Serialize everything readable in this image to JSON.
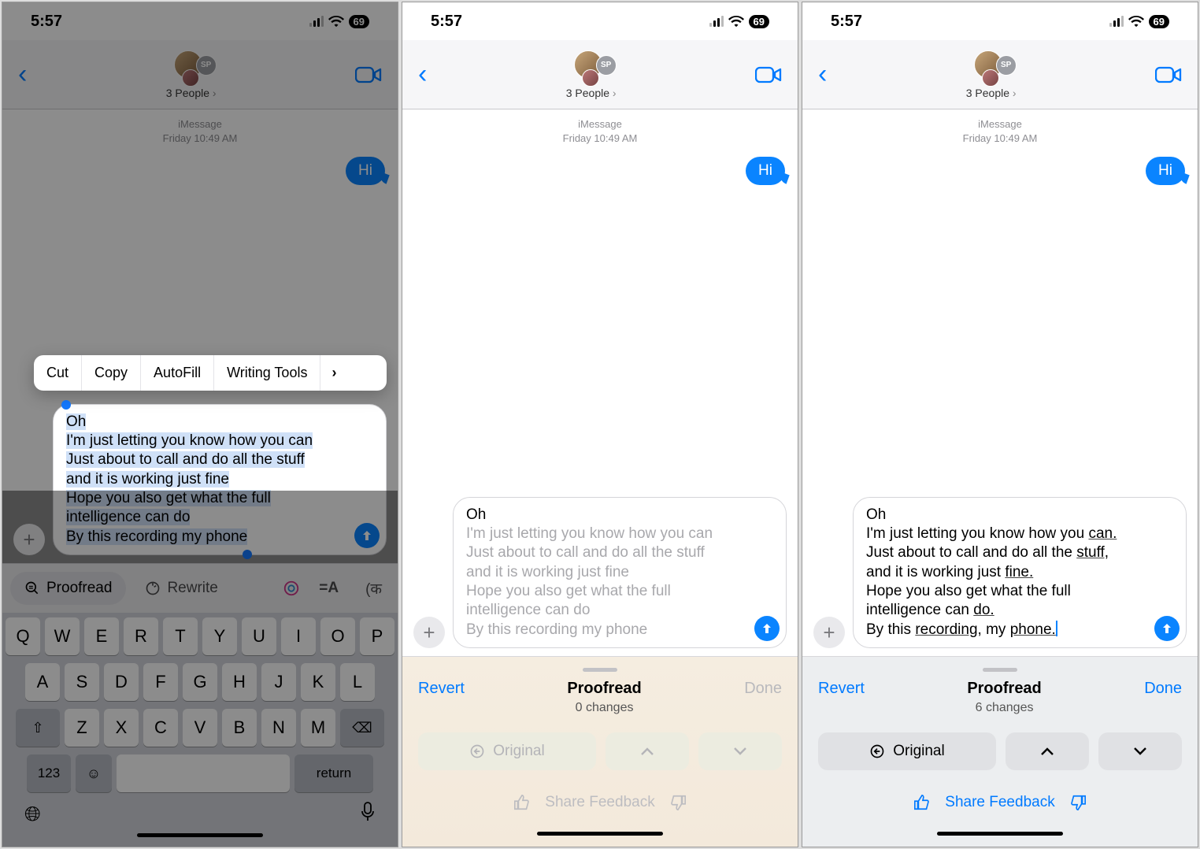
{
  "status": {
    "time": "5:57",
    "battery": "69"
  },
  "header": {
    "people": "3 People"
  },
  "thread": {
    "service": "iMessage",
    "timestamp": "Friday 10:49 AM",
    "hi": "Hi"
  },
  "compose": {
    "line1": "Oh",
    "line2": "I'm just letting you know how you can",
    "line3": "Just about to call and do all the stuff",
    "line4": "and it is working just fine",
    "line5": "Hope you also get what the full",
    "line6": "intelligence can do",
    "line7": "By this recording my phone"
  },
  "compose3": {
    "line2a": "I'm just letting you know how you ",
    "w_can": "can.",
    "line3a": "Just about to call and do all the ",
    "w_stuff": "stuff,",
    "line4a": "and it is working just ",
    "w_fine": "fine.",
    "line6a": "intelligence can ",
    "w_do": "do.",
    "line7a": "By this ",
    "w_rec": "recording,",
    "line7b": " my ",
    "w_phone": "phone."
  },
  "ctx": {
    "cut": "Cut",
    "copy": "Copy",
    "autofill": "AutoFill",
    "wt": "Writing Tools"
  },
  "wtbar": {
    "proofread": "Proofread",
    "rewrite": "Rewrite"
  },
  "kb": {
    "r1": [
      "Q",
      "W",
      "E",
      "R",
      "T",
      "Y",
      "U",
      "I",
      "O",
      "P"
    ],
    "r2": [
      "A",
      "S",
      "D",
      "F",
      "G",
      "H",
      "J",
      "K",
      "L"
    ],
    "r3": [
      "Z",
      "X",
      "C",
      "V",
      "B",
      "N",
      "M"
    ],
    "num": "123",
    "space": "",
    "return": "return"
  },
  "panel": {
    "revert": "Revert",
    "done": "Done",
    "title": "Proofread",
    "sub0": "0 changes",
    "sub6": "6 changes",
    "original": "Original",
    "feedback": "Share Feedback"
  }
}
